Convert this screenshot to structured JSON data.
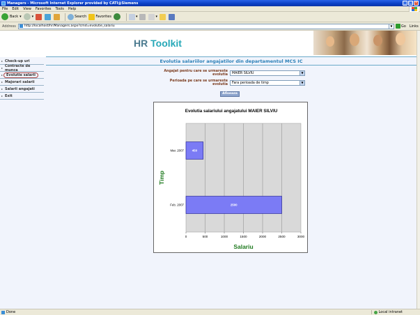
{
  "window": {
    "title": "Managers - Microsoft Internet Explorer provided by CATI@Siemens"
  },
  "menu": [
    "File",
    "Edit",
    "View",
    "Favorites",
    "Tools",
    "Help"
  ],
  "toolbar": {
    "back": "Back",
    "search": "Search",
    "favorites": "Favorites"
  },
  "address": {
    "label": "Address",
    "url": "http://localhost/hr/Managers.aspx?cmd=evolutie_salariu",
    "go": "Go",
    "links": "Links"
  },
  "app": {
    "logo_hr": "HR",
    "logo_toolkit": "Toolkit"
  },
  "sidebar": {
    "items": [
      {
        "label": "Check-up uri"
      },
      {
        "label": "Contracte de munca"
      },
      {
        "label": "Evolutie salarii"
      },
      {
        "label": "Majorari salarii"
      },
      {
        "label": "Salarii angajati"
      },
      {
        "label": "Exit"
      }
    ]
  },
  "page": {
    "title": "Evolutia salariilor angajatilor din departamentul MCS IC",
    "employee_label": "Angajat pentru care se urmareste evolutia",
    "employee_value": "MAIER SILVIU",
    "period_label": "Perioada pe care se urmareste evolutia",
    "period_value": "Fara perioada de timp",
    "show_button": "Afiseaza"
  },
  "chart_data": {
    "type": "bar",
    "orientation": "horizontal",
    "title": "Evolutia salariului angajatului MAIER SILVIU",
    "xlabel": "Salariu",
    "ylabel": "Timp",
    "categories": [
      "Mar. 2007",
      "Feb. 2007"
    ],
    "values": [
      450,
      2500
    ],
    "data_labels": [
      "450",
      "2500"
    ],
    "xlim": [
      0,
      3000
    ],
    "xticks": [
      "0",
      "500",
      "1000",
      "1500",
      "2000",
      "2500",
      "3000"
    ],
    "grid": true,
    "legend": "none",
    "bar_color": "#7b7bf5",
    "plot_bg": "#d9d9d9"
  },
  "status": {
    "left": "Done",
    "zone": "Local intranet"
  }
}
